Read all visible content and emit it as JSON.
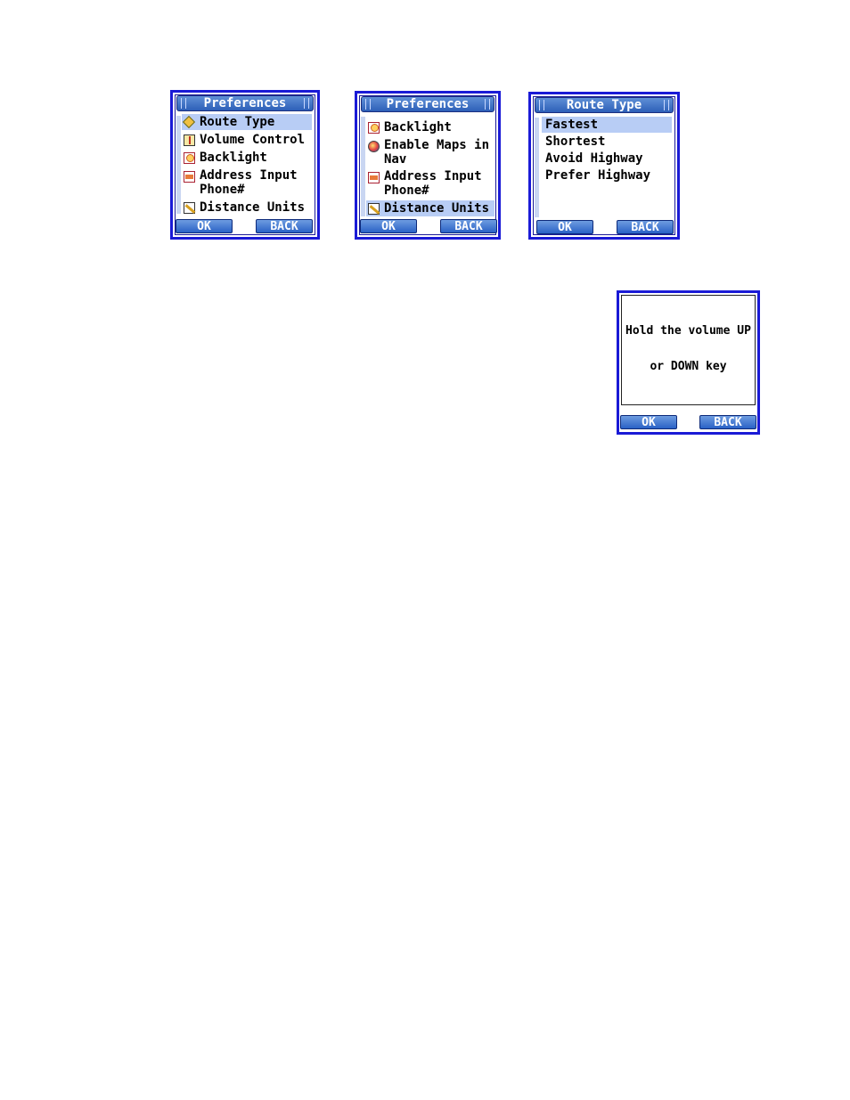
{
  "screens": [
    {
      "title": "Preferences",
      "items": [
        {
          "label": "Route Type",
          "icon": "diamond-sign-icon",
          "selected": true
        },
        {
          "label": "Volume Control",
          "icon": "volume-icon"
        },
        {
          "label": "Backlight",
          "icon": "lightbulb-icon"
        },
        {
          "label": "Address Input\nPhone#",
          "icon": "address-book-icon"
        },
        {
          "label": "Distance Units",
          "icon": "ruler-icon"
        }
      ],
      "ok": "OK",
      "back": "BACK"
    },
    {
      "title": "Preferences",
      "items": [
        {
          "label": "Backlight",
          "icon": "lightbulb-icon"
        },
        {
          "label": "Enable Maps in\nNav",
          "icon": "globe-icon"
        },
        {
          "label": "Address Input\nPhone#",
          "icon": "address-book-icon"
        },
        {
          "label": "Distance Units",
          "icon": "ruler-icon",
          "selected": true
        }
      ],
      "ok": "OK",
      "back": "BACK"
    },
    {
      "title": "Route Type",
      "items": [
        {
          "label": "Fastest",
          "selected": true
        },
        {
          "label": "Shortest"
        },
        {
          "label": "Avoid Highway"
        },
        {
          "label": "Prefer Highway"
        }
      ],
      "ok": "OK",
      "back": "BACK"
    },
    {
      "message_line1": "Hold the volume UP",
      "message_line2": "or DOWN key",
      "ok": "OK",
      "back": "BACK"
    }
  ]
}
